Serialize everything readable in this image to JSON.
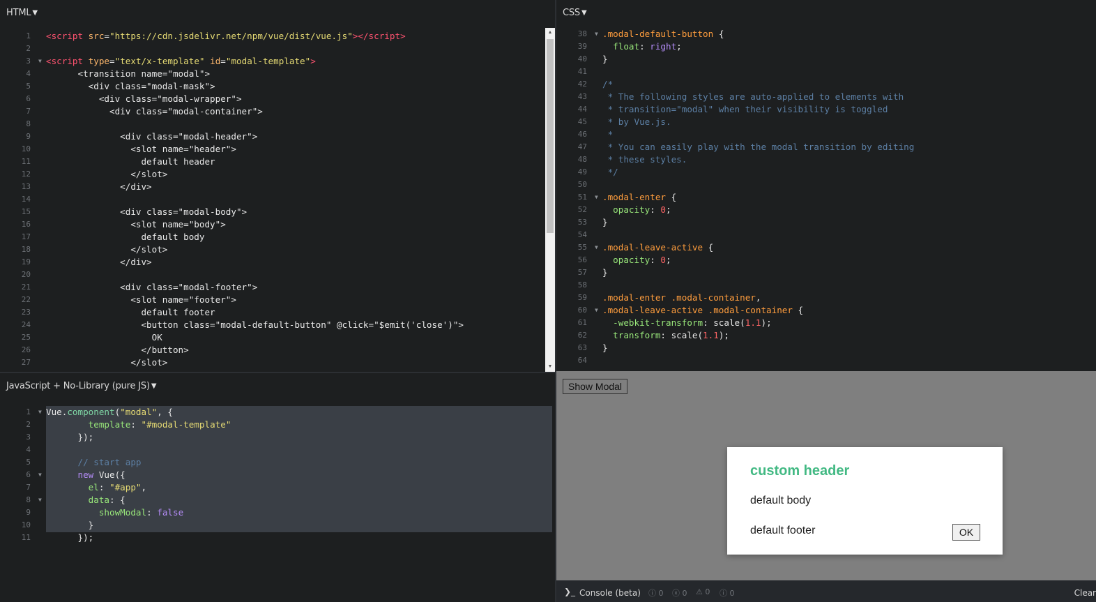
{
  "html_panel": {
    "title": "HTML",
    "lines": [
      {
        "n": "1",
        "fold": false,
        "parts": [
          [
            "t-tag",
            "<script "
          ],
          [
            "t-attr",
            "src"
          ],
          [
            "t-js",
            "="
          ],
          [
            "t-str",
            "\"https://cdn.jsdelivr.net/npm/vue/dist/vue.js\""
          ],
          [
            "t-tag",
            ">"
          ],
          [
            "t-tag",
            "</script"
          ],
          [
            "t-tag",
            ">"
          ]
        ]
      },
      {
        "n": "2",
        "fold": false,
        "parts": []
      },
      {
        "n": "3",
        "fold": true,
        "parts": [
          [
            "t-tag",
            "<script "
          ],
          [
            "t-attr",
            "type"
          ],
          [
            "t-js",
            "="
          ],
          [
            "t-str",
            "\"text/x-template\""
          ],
          [
            "t-js",
            " "
          ],
          [
            "t-attr",
            "id"
          ],
          [
            "t-js",
            "="
          ],
          [
            "t-str",
            "\"modal-template\""
          ],
          [
            "t-tag",
            ">"
          ]
        ]
      },
      {
        "n": "4",
        "fold": false,
        "parts": [
          [
            "t-js",
            "      <transition name=\"modal\">"
          ]
        ]
      },
      {
        "n": "5",
        "fold": false,
        "parts": [
          [
            "t-js",
            "        <div class=\"modal-mask\">"
          ]
        ]
      },
      {
        "n": "6",
        "fold": false,
        "parts": [
          [
            "t-js",
            "          <div class=\"modal-wrapper\">"
          ]
        ]
      },
      {
        "n": "7",
        "fold": false,
        "parts": [
          [
            "t-js",
            "            <div class=\"modal-container\">"
          ]
        ]
      },
      {
        "n": "8",
        "fold": false,
        "parts": []
      },
      {
        "n": "9",
        "fold": false,
        "parts": [
          [
            "t-js",
            "              <div class=\"modal-header\">"
          ]
        ]
      },
      {
        "n": "10",
        "fold": false,
        "parts": [
          [
            "t-js",
            "                <slot name=\"header\">"
          ]
        ]
      },
      {
        "n": "11",
        "fold": false,
        "parts": [
          [
            "t-js",
            "                  default header"
          ]
        ]
      },
      {
        "n": "12",
        "fold": false,
        "parts": [
          [
            "t-js",
            "                </slot>"
          ]
        ]
      },
      {
        "n": "13",
        "fold": false,
        "parts": [
          [
            "t-js",
            "              </div>"
          ]
        ]
      },
      {
        "n": "14",
        "fold": false,
        "parts": []
      },
      {
        "n": "15",
        "fold": false,
        "parts": [
          [
            "t-js",
            "              <div class=\"modal-body\">"
          ]
        ]
      },
      {
        "n": "16",
        "fold": false,
        "parts": [
          [
            "t-js",
            "                <slot name=\"body\">"
          ]
        ]
      },
      {
        "n": "17",
        "fold": false,
        "parts": [
          [
            "t-js",
            "                  default body"
          ]
        ]
      },
      {
        "n": "18",
        "fold": false,
        "parts": [
          [
            "t-js",
            "                </slot>"
          ]
        ]
      },
      {
        "n": "19",
        "fold": false,
        "parts": [
          [
            "t-js",
            "              </div>"
          ]
        ]
      },
      {
        "n": "20",
        "fold": false,
        "parts": []
      },
      {
        "n": "21",
        "fold": false,
        "parts": [
          [
            "t-js",
            "              <div class=\"modal-footer\">"
          ]
        ]
      },
      {
        "n": "22",
        "fold": false,
        "parts": [
          [
            "t-js",
            "                <slot name=\"footer\">"
          ]
        ]
      },
      {
        "n": "23",
        "fold": false,
        "parts": [
          [
            "t-js",
            "                  default footer"
          ]
        ]
      },
      {
        "n": "24",
        "fold": false,
        "parts": [
          [
            "t-js",
            "                  <button class=\"modal-default-button\" @click=\"$emit('close')\">"
          ]
        ]
      },
      {
        "n": "25",
        "fold": false,
        "parts": [
          [
            "t-js",
            "                    OK"
          ]
        ]
      },
      {
        "n": "26",
        "fold": false,
        "parts": [
          [
            "t-js",
            "                  </button>"
          ]
        ]
      },
      {
        "n": "27",
        "fold": false,
        "parts": [
          [
            "t-js",
            "                </slot>"
          ]
        ]
      }
    ]
  },
  "css_panel": {
    "title": "CSS",
    "lines": [
      {
        "n": "38",
        "fold": true,
        "parts": [
          [
            "t-sel",
            ".modal-default-button"
          ],
          [
            "t-js",
            " {"
          ]
        ]
      },
      {
        "n": "39",
        "fold": false,
        "parts": [
          [
            "t-prop",
            "  float"
          ],
          [
            "t-js",
            ": "
          ],
          [
            "t-kw",
            "right"
          ],
          [
            "t-js",
            ";"
          ]
        ]
      },
      {
        "n": "40",
        "fold": false,
        "parts": [
          [
            "t-js",
            "}"
          ]
        ]
      },
      {
        "n": "41",
        "fold": false,
        "parts": []
      },
      {
        "n": "42",
        "fold": false,
        "parts": [
          [
            "t-com",
            "/*"
          ]
        ]
      },
      {
        "n": "43",
        "fold": false,
        "parts": [
          [
            "t-com",
            " * The following styles are auto-applied to elements with"
          ]
        ]
      },
      {
        "n": "44",
        "fold": false,
        "parts": [
          [
            "t-com",
            " * transition=\"modal\" when their visibility is toggled"
          ]
        ]
      },
      {
        "n": "45",
        "fold": false,
        "parts": [
          [
            "t-com",
            " * by Vue.js."
          ]
        ]
      },
      {
        "n": "46",
        "fold": false,
        "parts": [
          [
            "t-com",
            " *"
          ]
        ]
      },
      {
        "n": "47",
        "fold": false,
        "parts": [
          [
            "t-com",
            " * You can easily play with the modal transition by editing"
          ]
        ]
      },
      {
        "n": "48",
        "fold": false,
        "parts": [
          [
            "t-com",
            " * these styles."
          ]
        ]
      },
      {
        "n": "49",
        "fold": false,
        "parts": [
          [
            "t-com",
            " */"
          ]
        ]
      },
      {
        "n": "50",
        "fold": false,
        "parts": []
      },
      {
        "n": "51",
        "fold": true,
        "parts": [
          [
            "t-sel",
            ".modal-enter"
          ],
          [
            "t-js",
            " {"
          ]
        ]
      },
      {
        "n": "52",
        "fold": false,
        "parts": [
          [
            "t-prop",
            "  opacity"
          ],
          [
            "t-js",
            ": "
          ],
          [
            "t-num",
            "0"
          ],
          [
            "t-js",
            ";"
          ]
        ]
      },
      {
        "n": "53",
        "fold": false,
        "parts": [
          [
            "t-js",
            "}"
          ]
        ]
      },
      {
        "n": "54",
        "fold": false,
        "parts": []
      },
      {
        "n": "55",
        "fold": true,
        "parts": [
          [
            "t-sel",
            ".modal-leave-active"
          ],
          [
            "t-js",
            " {"
          ]
        ]
      },
      {
        "n": "56",
        "fold": false,
        "parts": [
          [
            "t-prop",
            "  opacity"
          ],
          [
            "t-js",
            ": "
          ],
          [
            "t-num",
            "0"
          ],
          [
            "t-js",
            ";"
          ]
        ]
      },
      {
        "n": "57",
        "fold": false,
        "parts": [
          [
            "t-js",
            "}"
          ]
        ]
      },
      {
        "n": "58",
        "fold": false,
        "parts": []
      },
      {
        "n": "59",
        "fold": false,
        "parts": [
          [
            "t-sel",
            ".modal-enter .modal-container"
          ],
          [
            "t-js",
            ","
          ]
        ]
      },
      {
        "n": "60",
        "fold": true,
        "parts": [
          [
            "t-sel",
            ".modal-leave-active .modal-container"
          ],
          [
            "t-js",
            " {"
          ]
        ]
      },
      {
        "n": "61",
        "fold": false,
        "parts": [
          [
            "t-prop",
            "  -webkit-transform"
          ],
          [
            "t-js",
            ": scale("
          ],
          [
            "t-num",
            "1.1"
          ],
          [
            "t-js",
            ");"
          ]
        ]
      },
      {
        "n": "62",
        "fold": false,
        "parts": [
          [
            "t-prop",
            "  transform"
          ],
          [
            "t-js",
            ": scale("
          ],
          [
            "t-num",
            "1.1"
          ],
          [
            "t-js",
            ");"
          ]
        ]
      },
      {
        "n": "63",
        "fold": false,
        "parts": [
          [
            "t-js",
            "}"
          ]
        ]
      },
      {
        "n": "64",
        "fold": false,
        "parts": []
      }
    ]
  },
  "js_panel": {
    "title": "JavaScript + No-Library (pure JS)",
    "lines": [
      {
        "n": "1",
        "fold": true,
        "parts": [
          [
            "t-js",
            "Vue."
          ],
          [
            "t-fn",
            "component"
          ],
          [
            "t-js",
            "("
          ],
          [
            "t-str",
            "\"modal\""
          ],
          [
            "t-js",
            ", {"
          ]
        ]
      },
      {
        "n": "2",
        "fold": false,
        "parts": [
          [
            "t-js",
            "        "
          ],
          [
            "t-prop",
            "template"
          ],
          [
            "t-js",
            ": "
          ],
          [
            "t-str",
            "\"#modal-template\""
          ]
        ]
      },
      {
        "n": "3",
        "fold": false,
        "parts": [
          [
            "t-js",
            "      });"
          ]
        ]
      },
      {
        "n": "4",
        "fold": false,
        "parts": []
      },
      {
        "n": "5",
        "fold": false,
        "parts": [
          [
            "t-com",
            "      // start app"
          ]
        ]
      },
      {
        "n": "6",
        "fold": true,
        "parts": [
          [
            "t-js",
            "      "
          ],
          [
            "t-kw",
            "new"
          ],
          [
            "t-js",
            " Vue({"
          ]
        ]
      },
      {
        "n": "7",
        "fold": false,
        "parts": [
          [
            "t-js",
            "        "
          ],
          [
            "t-prop",
            "el"
          ],
          [
            "t-js",
            ": "
          ],
          [
            "t-str",
            "\"#app\""
          ],
          [
            "t-js",
            ","
          ]
        ]
      },
      {
        "n": "8",
        "fold": true,
        "parts": [
          [
            "t-js",
            "        "
          ],
          [
            "t-prop",
            "data"
          ],
          [
            "t-js",
            ": {"
          ]
        ]
      },
      {
        "n": "9",
        "fold": false,
        "parts": [
          [
            "t-js",
            "          "
          ],
          [
            "t-prop",
            "showModal"
          ],
          [
            "t-js",
            ": "
          ],
          [
            "t-kw",
            "false"
          ]
        ]
      },
      {
        "n": "10",
        "fold": false,
        "parts": [
          [
            "t-js",
            "        }"
          ]
        ]
      },
      {
        "n": "11",
        "fold": false,
        "parts": [
          [
            "t-js",
            "      });"
          ]
        ]
      }
    ]
  },
  "preview": {
    "show_button": "Show Modal",
    "modal_header": "custom header",
    "modal_body": "default body",
    "modal_footer": "default footer",
    "ok_button": "OK"
  },
  "console": {
    "prompt": "❯_",
    "label": "Console (beta)",
    "counts": [
      "0",
      "0",
      "0",
      "0"
    ],
    "clear": "Clear"
  },
  "colors": {
    "accent_green": "#42b983",
    "editor_bg": "#1d1f20"
  }
}
